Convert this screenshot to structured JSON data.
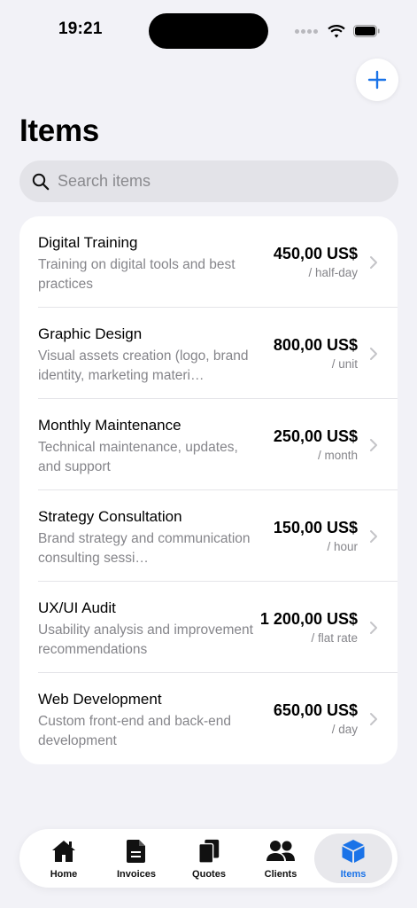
{
  "status_bar": {
    "time": "19:21"
  },
  "header": {
    "title": "Items"
  },
  "search": {
    "placeholder": "Search items"
  },
  "items": [
    {
      "name": "Digital Training",
      "description": "Training on digital tools and best practices",
      "price": "450,00 US$",
      "unit": "/ half-day"
    },
    {
      "name": "Graphic Design",
      "description": "Visual assets creation (logo, brand identity, marketing materi…",
      "price": "800,00 US$",
      "unit": "/ unit"
    },
    {
      "name": "Monthly Maintenance",
      "description": "Technical maintenance, updates, and support",
      "price": "250,00 US$",
      "unit": "/ month"
    },
    {
      "name": "Strategy Consultation",
      "description": "Brand strategy and communication consulting sessi…",
      "price": "150,00 US$",
      "unit": "/ hour"
    },
    {
      "name": "UX/UI Audit",
      "description": "Usability analysis and improvement recommendations",
      "price": "1 200,00 US$",
      "unit": "/ flat rate"
    },
    {
      "name": "Web Development",
      "description": "Custom front-end and back-end development",
      "price": "650,00 US$",
      "unit": "/ day"
    }
  ],
  "tabs": [
    {
      "label": "Home",
      "icon": "house-icon"
    },
    {
      "label": "Invoices",
      "icon": "document-icon"
    },
    {
      "label": "Quotes",
      "icon": "documents-icon"
    },
    {
      "label": "Clients",
      "icon": "people-icon"
    },
    {
      "label": "Items",
      "icon": "cube-icon",
      "active": true
    }
  ],
  "colors": {
    "accent": "#1a73e8",
    "background": "#f2f2f7",
    "secondary_text": "#85858a"
  }
}
